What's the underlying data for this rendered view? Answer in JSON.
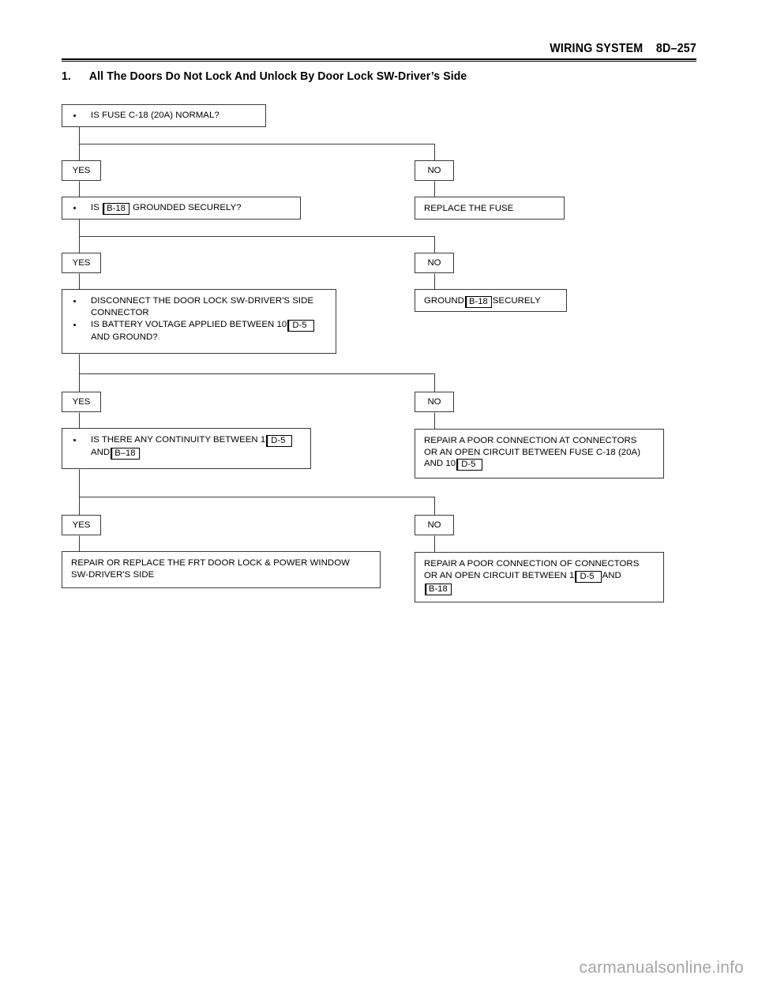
{
  "header": {
    "title": "WIRING SYSTEM    8D–257"
  },
  "section": {
    "number": "1.",
    "title": "All The Doors Do Not Lock And Unlock By Door Lock SW-Driver’s Side"
  },
  "flowchart": {
    "type": "troubleshooting-flowchart",
    "nodes": [
      {
        "id": "q1",
        "kind": "question",
        "lines": [
          "IS FUSE C-18 (20A) NORMAL?"
        ]
      },
      {
        "id": "b1-yes",
        "kind": "branch",
        "label": "YES"
      },
      {
        "id": "b1-no",
        "kind": "branch",
        "label": "NO"
      },
      {
        "id": "q2",
        "kind": "question",
        "pre": "IS",
        "chip": "B-18",
        "post": "GROUNDED SECURELY?"
      },
      {
        "id": "a1",
        "kind": "action",
        "lines": [
          "REPLACE THE FUSE"
        ]
      },
      {
        "id": "b2-yes",
        "kind": "branch",
        "label": "YES"
      },
      {
        "id": "b2-no",
        "kind": "branch",
        "label": "NO"
      },
      {
        "id": "q3",
        "kind": "question",
        "bullet1_l1": "DISCONNECT THE DOOR LOCK SW-DRIVER'S SIDE",
        "bullet1_l2": "CONNECTOR",
        "bullet2_pre": "IS BATTERY VOLTAGE APPLIED BETWEEN 10",
        "bullet2_chip": "D-5",
        "bullet2_post": "AND GROUND?"
      },
      {
        "id": "a2",
        "kind": "action",
        "pre": "GROUND",
        "chip": "B-18",
        "post": "SECURELY"
      },
      {
        "id": "b3-yes",
        "kind": "branch",
        "label": "YES"
      },
      {
        "id": "b3-no",
        "kind": "branch",
        "label": "NO"
      },
      {
        "id": "q4",
        "kind": "question",
        "pre": "IS THERE ANY CONTINUITY BETWEEN  1",
        "chip1": "D-5",
        "mid": "AND",
        "chip2": "B–18"
      },
      {
        "id": "a3",
        "kind": "action",
        "l1": "REPAIR A POOR CONNECTION AT CONNECTORS",
        "l2": "OR AN OPEN CIRCUIT BETWEEN FUSE C-18 (20A)",
        "l3_pre": "AND 10",
        "l3_chip": "D-5"
      },
      {
        "id": "b4-yes",
        "kind": "branch",
        "label": "YES"
      },
      {
        "id": "b4-no",
        "kind": "branch",
        "label": "NO"
      },
      {
        "id": "a4",
        "kind": "action",
        "l1": "REPAIR OR REPLACE THE FRT DOOR LOCK & POWER WINDOW",
        "l2": "SW-DRIVER'S SIDE"
      },
      {
        "id": "a5",
        "kind": "action",
        "l1": "REPAIR A POOR CONNECTION OF CONNECTORS",
        "l2_pre": "OR AN OPEN CIRCUIT BETWEEN  1",
        "l2_chip": "D-5",
        "l2_post": "AND",
        "l3_chip": "B-18"
      }
    ]
  },
  "watermark": {
    "text": "carmanualsonline.info"
  },
  "colors": {
    "ink": "#000000",
    "box_border": "#3a3a3a",
    "watermark": "#a6a6a6",
    "background": "#ffffff"
  }
}
